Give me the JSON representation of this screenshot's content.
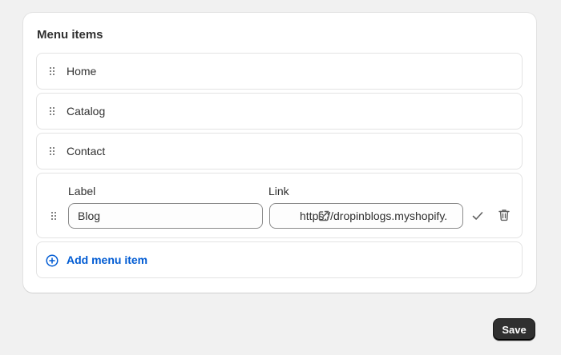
{
  "menu": {
    "title": "Menu items",
    "items": [
      {
        "label": "Home",
        "icon": "drag-handle-icon"
      },
      {
        "label": "Catalog",
        "icon": "drag-handle-icon"
      },
      {
        "label": "Contact",
        "icon": "drag-handle-icon"
      }
    ],
    "editing": {
      "label_heading": "Label",
      "label_value": "Blog",
      "link_heading": "Link",
      "link_value": "https://dropinblogs.myshopify.",
      "link_icon": "external-link-icon",
      "confirm_icon": "checkmark-icon",
      "delete_icon": "trash-icon"
    },
    "add_item_label": "Add menu item",
    "add_item_icon": "plus-circle-icon"
  },
  "footer": {
    "save_label": "Save"
  },
  "colors": {
    "accent_link": "#005bd3",
    "primary_button": "#303030",
    "page_background": "#f1f1f1"
  }
}
